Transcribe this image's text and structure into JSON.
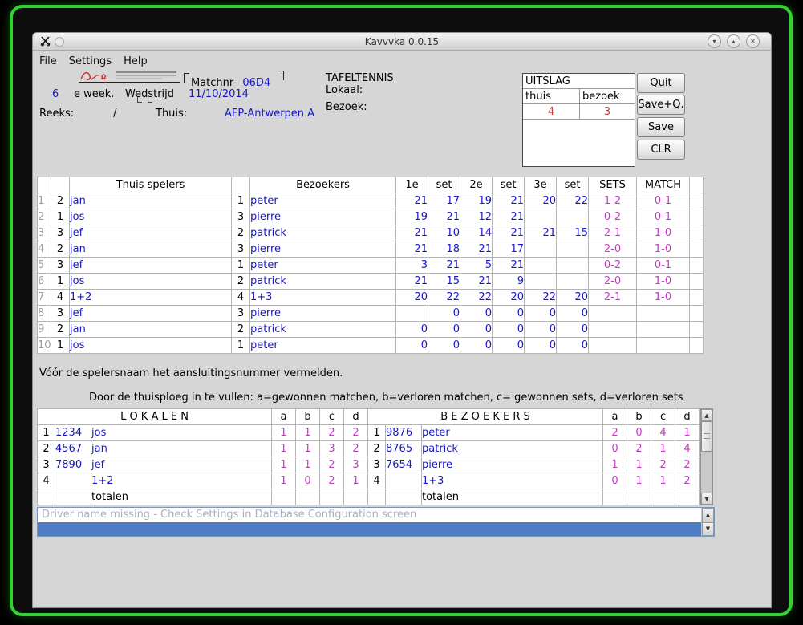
{
  "window": {
    "title": "Kavvvka 0.0.15",
    "menu": [
      "File",
      "Settings",
      "Help"
    ]
  },
  "form": {
    "week_number": "6",
    "week_suffix": "e week.",
    "wedstrijd_label": "Wedstrijd",
    "matchnr_label": "Matchnr",
    "matchnr_value": "06D4",
    "match_date": "11/10/2014",
    "sport_title": "TAFELTENNIS",
    "lokaal_label": "Lokaal:",
    "bezoek_label": "Bezoek:",
    "reeks_label": "Reeks:",
    "reeks_separator": "/",
    "thuis_label": "Thuis:",
    "thuis_value": "AFP-Antwerpen A",
    "uitslag": {
      "title": "UITSLAG",
      "home_label": "thuis",
      "visitor_label": "bezoek",
      "home_score": "4",
      "visitor_score": "3"
    },
    "buttons": [
      "Quit",
      "Save+Q.",
      "Save",
      "CLR"
    ]
  },
  "match_table": {
    "headers": [
      "",
      "",
      "Thuis spelers",
      "",
      "Bezoekers",
      "1e",
      "set",
      "2e",
      "set",
      "3e",
      "set",
      "SETS",
      "MATCH",
      ""
    ],
    "rows": [
      {
        "n": "1",
        "home_num": "2",
        "home": "jan",
        "visitor_num": "1",
        "visitor": "peter",
        "scores": [
          "21",
          "17",
          "19",
          "21",
          "20",
          "22"
        ],
        "sets": "1-2",
        "match": "0-1"
      },
      {
        "n": "2",
        "home_num": "1",
        "home": "jos",
        "visitor_num": "3",
        "visitor": "pierre",
        "scores": [
          "19",
          "21",
          "12",
          "21",
          "",
          ""
        ],
        "sets": "0-2",
        "match": "0-1"
      },
      {
        "n": "3",
        "home_num": "3",
        "home": "jef",
        "visitor_num": "2",
        "visitor": "patrick",
        "scores": [
          "21",
          "10",
          "14",
          "21",
          "21",
          "15"
        ],
        "sets": "2-1",
        "match": "1-0"
      },
      {
        "n": "4",
        "home_num": "2",
        "home": "jan",
        "visitor_num": "3",
        "visitor": "pierre",
        "scores": [
          "21",
          "18",
          "21",
          "17",
          "",
          ""
        ],
        "sets": "2-0",
        "match": "1-0"
      },
      {
        "n": "5",
        "home_num": "3",
        "home": "jef",
        "visitor_num": "1",
        "visitor": "peter",
        "scores": [
          "3",
          "21",
          "5",
          "21",
          "",
          ""
        ],
        "sets": "0-2",
        "match": "0-1"
      },
      {
        "n": "6",
        "home_num": "1",
        "home": "jos",
        "visitor_num": "2",
        "visitor": "patrick",
        "scores": [
          "21",
          "15",
          "21",
          "9",
          "",
          ""
        ],
        "sets": "2-0",
        "match": "1-0"
      },
      {
        "n": "7",
        "home_num": "4",
        "home": "1+2",
        "visitor_num": "4",
        "visitor": "1+3",
        "scores": [
          "20",
          "22",
          "22",
          "20",
          "22",
          "20"
        ],
        "sets": "2-1",
        "match": "1-0"
      },
      {
        "n": "8",
        "home_num": "3",
        "home": "jef",
        "visitor_num": "3",
        "visitor": "pierre",
        "scores": [
          "",
          "0",
          "0",
          "0",
          "0",
          "0"
        ],
        "sets": "",
        "match": ""
      },
      {
        "n": "9",
        "home_num": "2",
        "home": "jan",
        "visitor_num": "2",
        "visitor": "patrick",
        "scores": [
          "0",
          "0",
          "0",
          "0",
          "0",
          "0"
        ],
        "sets": "",
        "match": ""
      },
      {
        "n": "10",
        "home_num": "1",
        "home": "jos",
        "visitor_num": "1",
        "visitor": "peter",
        "scores": [
          "0",
          "0",
          "0",
          "0",
          "0",
          "0"
        ],
        "sets": "",
        "match": ""
      }
    ]
  },
  "notes": {
    "note1": "Vóór de spelersnaam het aansluitingsnummer vermelden.",
    "note2": "Door de thuisploeg in te vullen: a=gewonnen matchen, b=verloren matchen, c= gewonnen sets, d=verloren sets"
  },
  "summary_table": {
    "left_title": "L O K A L E N",
    "right_title": "B E Z O E K E R S",
    "col_labels": [
      "a",
      "b",
      "c",
      "d"
    ],
    "totals_label": "totalen",
    "rows": [
      {
        "left": {
          "n": "1",
          "num": "1234",
          "name": "jos",
          "vals": [
            "1",
            "1",
            "2",
            "2"
          ]
        },
        "right": {
          "n": "1",
          "num": "9876",
          "name": "peter",
          "vals": [
            "2",
            "0",
            "4",
            "1"
          ]
        }
      },
      {
        "left": {
          "n": "2",
          "num": "4567",
          "name": "jan",
          "vals": [
            "1",
            "1",
            "3",
            "2"
          ]
        },
        "right": {
          "n": "2",
          "num": "8765",
          "name": "patrick",
          "vals": [
            "0",
            "2",
            "1",
            "4"
          ]
        }
      },
      {
        "left": {
          "n": "3",
          "num": "7890",
          "name": "jef",
          "vals": [
            "1",
            "1",
            "2",
            "3"
          ]
        },
        "right": {
          "n": "3",
          "num": "7654",
          "name": "pierre",
          "vals": [
            "1",
            "1",
            "2",
            "2"
          ]
        }
      },
      {
        "left": {
          "n": "4",
          "num": "",
          "name": "1+2",
          "vals": [
            "1",
            "0",
            "2",
            "1"
          ]
        },
        "right": {
          "n": "4",
          "num": "",
          "name": "1+3",
          "vals": [
            "0",
            "1",
            "1",
            "2"
          ]
        }
      }
    ]
  },
  "status": {
    "message": "Driver name missing - Check Settings in Database Configuration screen"
  },
  "colors": {
    "accent_green": "#2fd32f",
    "value_blue": "#1818c8",
    "result_magenta": "#c23cc2",
    "score_red": "#cc3b3b",
    "selection_blue": "#4e7dc6"
  }
}
